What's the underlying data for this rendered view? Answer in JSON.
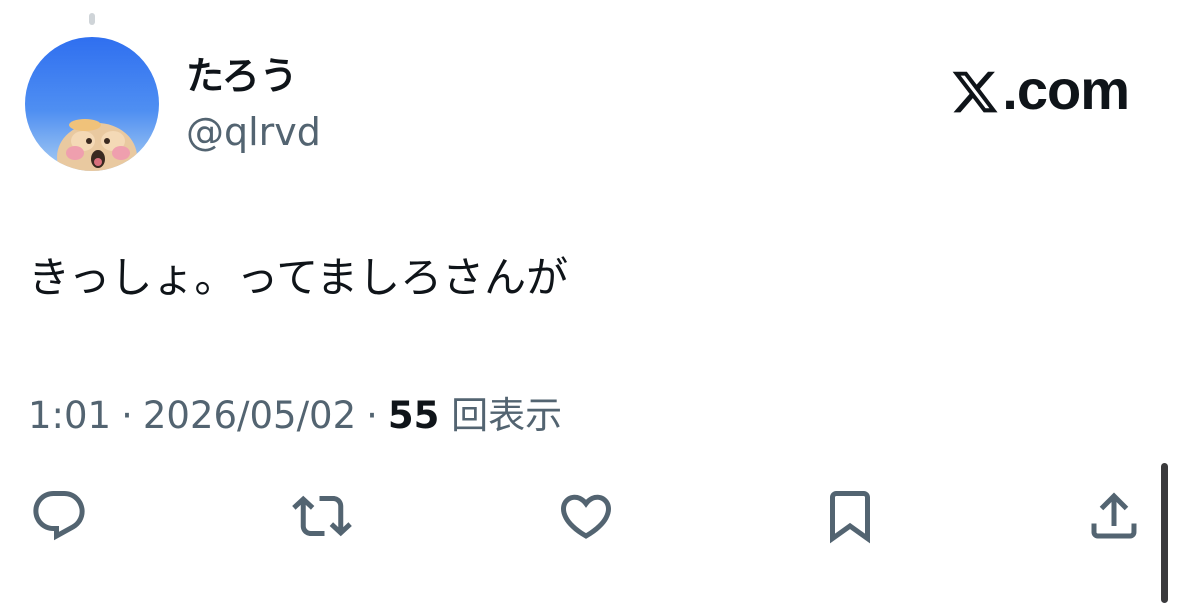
{
  "user": {
    "display_name": "たろう",
    "handle": "@qlrvd",
    "avatar": "avatar-image"
  },
  "brand": {
    "logo": "x-logo-icon",
    "text": ".com"
  },
  "tweet": {
    "text": "きっしょ。ってましろさんが"
  },
  "meta": {
    "time": "1:01",
    "separator": "·",
    "date": "2026/05/02",
    "views_count": "55",
    "views_label": "回表示"
  },
  "actions": [
    {
      "name": "reply",
      "icon": "reply-icon"
    },
    {
      "name": "repost",
      "icon": "repost-icon"
    },
    {
      "name": "like",
      "icon": "heart-icon"
    },
    {
      "name": "bookmark",
      "icon": "bookmark-icon"
    },
    {
      "name": "share",
      "icon": "share-icon"
    }
  ],
  "colors": {
    "text": "#0f1419",
    "secondary": "#536471",
    "icon": "#536471",
    "background": "#ffffff"
  }
}
